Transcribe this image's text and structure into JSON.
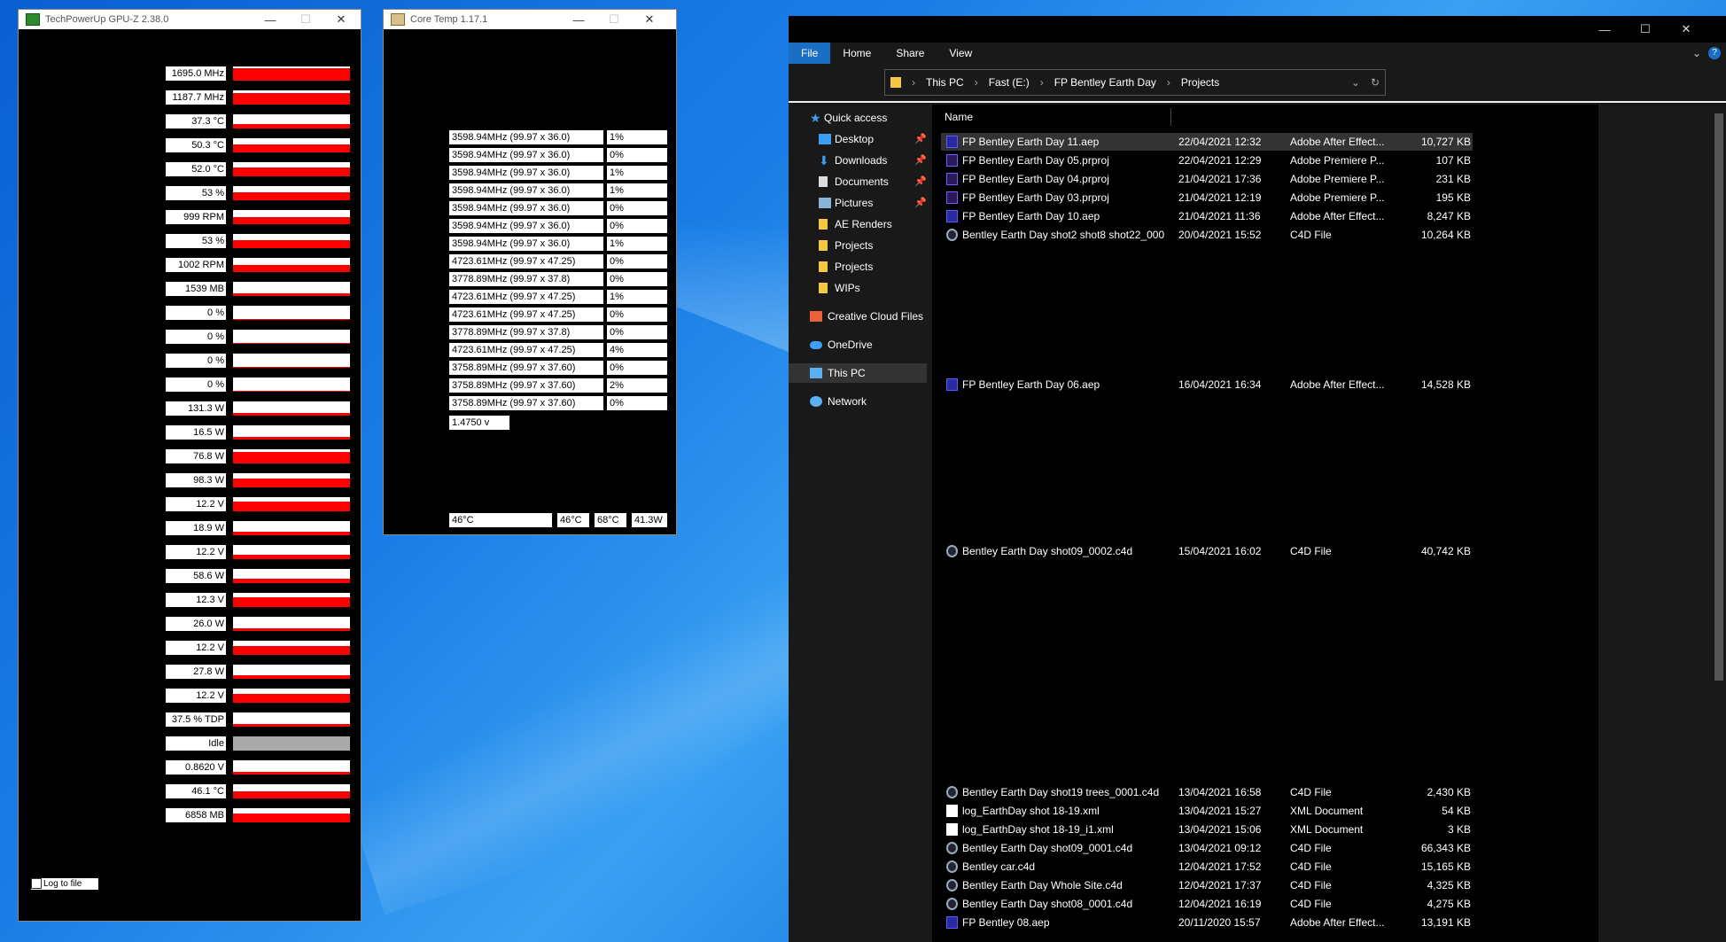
{
  "gpuz": {
    "title": "TechPowerUp GPU-Z 2.38.0",
    "rows": [
      {
        "value": "1695.0 MHz",
        "fill": 0.85
      },
      {
        "value": "1187.7 MHz",
        "fill": 0.8
      },
      {
        "value": "37.3 °C",
        "fill": 0.3
      },
      {
        "value": "50.3 °C",
        "fill": 0.55
      },
      {
        "value": "52.0 °C",
        "fill": 0.6
      },
      {
        "value": "53 %",
        "fill": 0.55
      },
      {
        "value": "999 RPM",
        "fill": 0.5
      },
      {
        "value": "53 %",
        "fill": 0.55
      },
      {
        "value": "1002 RPM",
        "fill": 0.5
      },
      {
        "value": "1539 MB",
        "fill": 0.2
      },
      {
        "value": "0 %",
        "fill": 0.05
      },
      {
        "value": "0 %",
        "fill": 0.05
      },
      {
        "value": "0 %",
        "fill": 0.05
      },
      {
        "value": "0 %",
        "fill": 0.05
      },
      {
        "value": "131.3 W",
        "fill": 0.2
      },
      {
        "value": "16.5 W",
        "fill": 0.2
      },
      {
        "value": "76.8 W",
        "fill": 0.8
      },
      {
        "value": "98.3 W",
        "fill": 0.6
      },
      {
        "value": "12.2 V",
        "fill": 0.7
      },
      {
        "value": "18.9 W",
        "fill": 0.25
      },
      {
        "value": "12.2 V",
        "fill": 0.3
      },
      {
        "value": "58.6 W",
        "fill": 0.3
      },
      {
        "value": "12.3 V",
        "fill": 0.7
      },
      {
        "value": "26.0 W",
        "fill": 0.2
      },
      {
        "value": "12.2 V",
        "fill": 0.65
      },
      {
        "value": "27.8 W",
        "fill": 0.25
      },
      {
        "value": "12.2 V",
        "fill": 0.65
      },
      {
        "value": "37.5 % TDP",
        "fill": 0.2
      },
      {
        "value": "Idle",
        "fill": 0.0
      },
      {
        "value": "0.8620 V",
        "fill": 0.2
      },
      {
        "value": "46.1 °C",
        "fill": 0.5
      },
      {
        "value": "6858 MB",
        "fill": 0.6
      }
    ],
    "log_label": "Log to file"
  },
  "coretemp": {
    "title": "Core Temp 1.17.1",
    "rows": [
      {
        "freq": "3598.94MHz (99.97 x 36.0)",
        "load": "1%"
      },
      {
        "freq": "3598.94MHz (99.97 x 36.0)",
        "load": "0%"
      },
      {
        "freq": "3598.94MHz (99.97 x 36.0)",
        "load": "1%"
      },
      {
        "freq": "3598.94MHz (99.97 x 36.0)",
        "load": "1%"
      },
      {
        "freq": "3598.94MHz (99.97 x 36.0)",
        "load": "0%"
      },
      {
        "freq": "3598.94MHz (99.97 x 36.0)",
        "load": "0%"
      },
      {
        "freq": "3598.94MHz (99.97 x 36.0)",
        "load": "1%"
      },
      {
        "freq": "4723.61MHz (99.97 x 47.25)",
        "load": "0%"
      },
      {
        "freq": "3778.89MHz (99.97 x 37.8)",
        "load": "0%"
      },
      {
        "freq": "4723.61MHz (99.97 x 47.25)",
        "load": "1%"
      },
      {
        "freq": "4723.61MHz (99.97 x 47.25)",
        "load": "0%"
      },
      {
        "freq": "3778.89MHz (99.97 x 37.8)",
        "load": "0%"
      },
      {
        "freq": "4723.61MHz (99.97 x 47.25)",
        "load": "4%"
      },
      {
        "freq": "3758.89MHz (99.97 x 37.60)",
        "load": "0%"
      },
      {
        "freq": "3758.89MHz (99.97 x 37.60)",
        "load": "2%"
      },
      {
        "freq": "3758.89MHz (99.97 x 37.60)",
        "load": "0%"
      }
    ],
    "vid": "1.4750 v",
    "footer": {
      "temp1": "46°C",
      "temp2": "46°C",
      "temp3": "68°C",
      "power": "41.3W"
    }
  },
  "explorer": {
    "tabs": [
      "File",
      "Home",
      "Share",
      "View"
    ],
    "breadcrumb": [
      "This PC",
      "Fast (E:)",
      "FP Bentley Earth Day",
      "Projects"
    ],
    "col_name": "Name",
    "nav": {
      "quick_access": "Quick access",
      "desktop": "Desktop",
      "downloads": "Downloads",
      "documents": "Documents",
      "pictures": "Pictures",
      "ae_renders": "AE Renders",
      "projects1": "Projects",
      "projects2": "Projects",
      "wips": "WIPs",
      "creative_cloud": "Creative Cloud Files",
      "onedrive": "OneDrive",
      "this_pc": "This PC",
      "network": "Network"
    },
    "files": [
      {
        "name": "FP Bentley Earth Day 11.aep",
        "date": "22/04/2021 12:32",
        "type": "Adobe After Effect...",
        "size": "10,727 KB",
        "icon": "aep"
      },
      {
        "name": "FP Bentley Earth Day 05.prproj",
        "date": "22/04/2021 12:29",
        "type": "Adobe Premiere P...",
        "size": "107 KB",
        "icon": "pr"
      },
      {
        "name": "FP Bentley Earth Day 04.prproj",
        "date": "21/04/2021 17:36",
        "type": "Adobe Premiere P...",
        "size": "231 KB",
        "icon": "pr"
      },
      {
        "name": "FP Bentley Earth Day 03.prproj",
        "date": "21/04/2021 12:19",
        "type": "Adobe Premiere P...",
        "size": "195 KB",
        "icon": "pr"
      },
      {
        "name": "FP Bentley Earth Day 10.aep",
        "date": "21/04/2021 11:36",
        "type": "Adobe After Effect...",
        "size": "8,247 KB",
        "icon": "aep"
      },
      {
        "name": "Bentley Earth Day shot2 shot8 shot22_000...",
        "date": "20/04/2021 15:52",
        "type": "C4D File",
        "size": "10,264 KB",
        "icon": "c4d"
      },
      {
        "name": "FP Bentley Earth Day 06.aep",
        "date": "16/04/2021 16:34",
        "type": "Adobe After Effect...",
        "size": "14,528 KB",
        "icon": "aep"
      },
      {
        "name": "Bentley Earth Day shot09_0002.c4d",
        "date": "15/04/2021 16:02",
        "type": "C4D File",
        "size": "40,742 KB",
        "icon": "c4d"
      },
      {
        "name": "Bentley Earth Day shot19 trees_0001.c4d",
        "date": "13/04/2021 16:58",
        "type": "C4D File",
        "size": "2,430 KB",
        "icon": "c4d"
      },
      {
        "name": "log_EarthDay shot 18-19.xml",
        "date": "13/04/2021 15:27",
        "type": "XML Document",
        "size": "54 KB",
        "icon": "xml"
      },
      {
        "name": "log_EarthDay shot 18-19_i1.xml",
        "date": "13/04/2021 15:06",
        "type": "XML Document",
        "size": "3 KB",
        "icon": "xml"
      },
      {
        "name": "Bentley Earth Day shot09_0001.c4d",
        "date": "13/04/2021 09:12",
        "type": "C4D File",
        "size": "66,343 KB",
        "icon": "c4d"
      },
      {
        "name": "Bentley car.c4d",
        "date": "12/04/2021 17:52",
        "type": "C4D File",
        "size": "15,165 KB",
        "icon": "c4d"
      },
      {
        "name": "Bentley Earth Day Whole Site.c4d",
        "date": "12/04/2021 17:37",
        "type": "C4D File",
        "size": "4,325 KB",
        "icon": "c4d"
      },
      {
        "name": "Bentley Earth Day shot08_0001.c4d",
        "date": "12/04/2021 16:19",
        "type": "C4D File",
        "size": "4,275 KB",
        "icon": "c4d"
      },
      {
        "name": "FP Bentley 08.aep",
        "date": "20/11/2020 15:57",
        "type": "Adobe After Effect...",
        "size": "13,191 KB",
        "icon": "aep"
      }
    ]
  }
}
